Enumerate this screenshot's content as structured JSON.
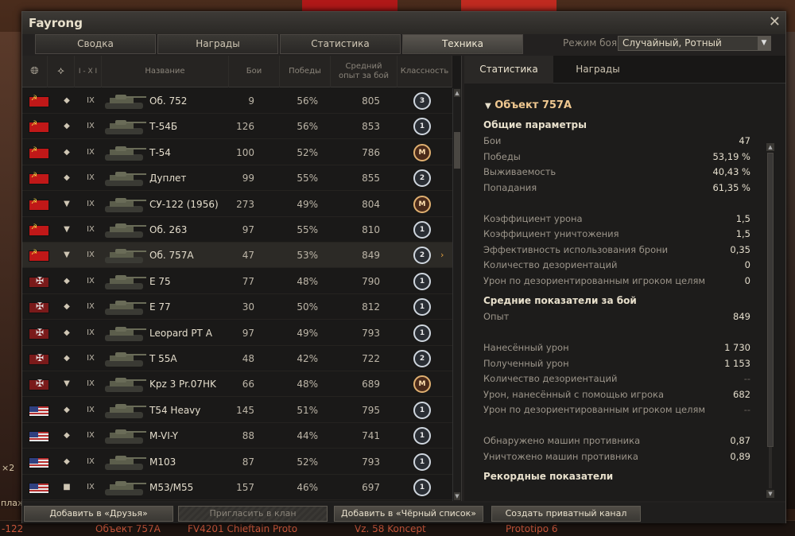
{
  "window": {
    "title": "Fayrong"
  },
  "tabs": [
    "Сводка",
    "Награды",
    "Статистика",
    "Техника"
  ],
  "mode": {
    "label": "Режим боя:",
    "value": "Случайный, Ротный"
  },
  "table": {
    "headers": {
      "tier": "I - X I",
      "name": "Название",
      "battles": "Бои",
      "wins": "Победы",
      "exp1": "Средний",
      "exp2": "опыт за бой",
      "mastery": "Классность"
    },
    "rows": [
      {
        "nation": "ussr",
        "class": "◆",
        "tier": "IX",
        "name": "Об. 752",
        "battles": "9",
        "wins": "56%",
        "exp": "805",
        "mastery": "3"
      },
      {
        "nation": "ussr",
        "class": "◆",
        "tier": "IX",
        "name": "Т-54Б",
        "battles": "126",
        "wins": "56%",
        "exp": "853",
        "mastery": "1"
      },
      {
        "nation": "ussr",
        "class": "◆",
        "tier": "IX",
        "name": "Т-54",
        "battles": "100",
        "wins": "52%",
        "exp": "786",
        "mastery": "M"
      },
      {
        "nation": "ussr",
        "class": "◆",
        "tier": "IX",
        "name": "Дуплет",
        "battles": "99",
        "wins": "55%",
        "exp": "855",
        "mastery": "2"
      },
      {
        "nation": "ussr",
        "class": "▼",
        "tier": "IX",
        "name": "СУ-122 (1956)",
        "battles": "273",
        "wins": "49%",
        "exp": "804",
        "mastery": "M"
      },
      {
        "nation": "ussr",
        "class": "▼",
        "tier": "IX",
        "name": "Об. 263",
        "battles": "97",
        "wins": "55%",
        "exp": "810",
        "mastery": "1"
      },
      {
        "nation": "ussr",
        "class": "▼",
        "tier": "IX",
        "name": "Об. 757А",
        "battles": "47",
        "wins": "53%",
        "exp": "849",
        "mastery": "2",
        "selected": true
      },
      {
        "nation": "ger",
        "class": "◆",
        "tier": "IX",
        "name": "E 75",
        "battles": "77",
        "wins": "48%",
        "exp": "790",
        "mastery": "1"
      },
      {
        "nation": "ger",
        "class": "◆",
        "tier": "IX",
        "name": "E 77",
        "battles": "30",
        "wins": "50%",
        "exp": "812",
        "mastery": "1"
      },
      {
        "nation": "ger",
        "class": "◆",
        "tier": "IX",
        "name": "Leopard PT A",
        "battles": "97",
        "wins": "49%",
        "exp": "793",
        "mastery": "1"
      },
      {
        "nation": "ger",
        "class": "◆",
        "tier": "IX",
        "name": "T 55A",
        "battles": "48",
        "wins": "42%",
        "exp": "722",
        "mastery": "2"
      },
      {
        "nation": "ger",
        "class": "▼",
        "tier": "IX",
        "name": "Kpz 3 Pr.07HK",
        "battles": "66",
        "wins": "48%",
        "exp": "689",
        "mastery": "M"
      },
      {
        "nation": "usa",
        "class": "◆",
        "tier": "IX",
        "name": "T54 Heavy",
        "battles": "145",
        "wins": "51%",
        "exp": "795",
        "mastery": "1"
      },
      {
        "nation": "usa",
        "class": "◆",
        "tier": "IX",
        "name": "M-VI-Y",
        "battles": "88",
        "wins": "44%",
        "exp": "741",
        "mastery": "1"
      },
      {
        "nation": "usa",
        "class": "◆",
        "tier": "IX",
        "name": "M103",
        "battles": "87",
        "wins": "52%",
        "exp": "793",
        "mastery": "1"
      },
      {
        "nation": "usa",
        "class": "■",
        "tier": "IX",
        "name": "M53/M55",
        "battles": "157",
        "wins": "46%",
        "exp": "697",
        "mastery": "1"
      }
    ]
  },
  "right": {
    "tabs": [
      "Статистика",
      "Награды"
    ],
    "vehicle": "Объект 757А",
    "sections": [
      {
        "type": "section",
        "label": "Общие параметры"
      },
      {
        "type": "kv",
        "k": "Бои",
        "v": "47"
      },
      {
        "type": "kv",
        "k": "Победы",
        "v": "53,19 %"
      },
      {
        "type": "kv",
        "k": "Выживаемость",
        "v": "40,43 %"
      },
      {
        "type": "kv",
        "k": "Попадания",
        "v": "61,35 %"
      },
      {
        "type": "gap"
      },
      {
        "type": "kv",
        "k": "Коэффициент урона",
        "v": "1,5"
      },
      {
        "type": "kv",
        "k": "Коэффициент уничтожения",
        "v": "1,5"
      },
      {
        "type": "kv",
        "k": "Эффективность использования брони",
        "v": "0,35"
      },
      {
        "type": "kv",
        "k": "Количество дезориентаций",
        "v": "0"
      },
      {
        "type": "kv",
        "k": "Урон по дезориентированным игроком целям",
        "v": "0"
      },
      {
        "type": "section",
        "label": "Средние показатели за бой"
      },
      {
        "type": "kv",
        "k": "Опыт",
        "v": "849"
      },
      {
        "type": "gap"
      },
      {
        "type": "kv",
        "k": "Нанесённый урон",
        "v": "1 730"
      },
      {
        "type": "kv",
        "k": "Полученный урон",
        "v": "1 153"
      },
      {
        "type": "kv",
        "k": "Количество дезориентаций",
        "v": "--",
        "dim": true
      },
      {
        "type": "kv",
        "k": "Урон, нанесённый с помощью игрока",
        "v": "682"
      },
      {
        "type": "kv",
        "k": "Урон по дезориентированным игроком целям",
        "v": "--",
        "dim": true
      },
      {
        "type": "gap"
      },
      {
        "type": "kv",
        "k": "Обнаружено машин противника",
        "v": "0,87"
      },
      {
        "type": "kv",
        "k": "Уничтожено машин противника",
        "v": "0,89"
      },
      {
        "type": "section",
        "label": "Рекордные показатели"
      }
    ]
  },
  "buttons": {
    "add_friends": "Добавить в «Друзья»",
    "invite_clan": "Пригласить в клан",
    "add_blacklist": "Добавить в «Чёрный список»",
    "private_channel": "Создать приватный канал"
  },
  "background": {
    "taskbar": [
      "-122",
      "Объект 757А",
      "FV4201 Chieftain Proto",
      "Vz. 58 Koncept",
      "Prototipo 6"
    ],
    "left_labels": [
      "×2",
      "плаж"
    ]
  }
}
